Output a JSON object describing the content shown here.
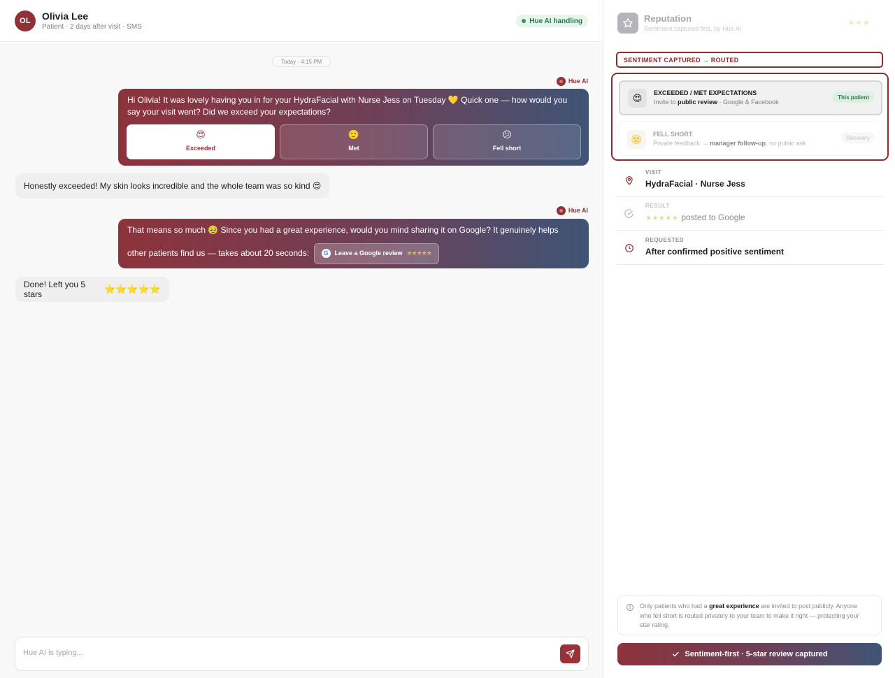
{
  "chat": {
    "header": {
      "avatar_initials": "OL",
      "name": "Olivia Lee",
      "meta": "Patient · 2 days after visit · SMS",
      "status": "Hue AI handling"
    },
    "date_chip": "Today · 4:15 PM",
    "ai_sender": "Hue AI",
    "messages": [
      {
        "sender": "Hue AI",
        "text": "Hi Olivia! It was lovely having you in for your HydraFacial with Nurse Jess on Tuesday 💛 Quick one — how would you say your visit went? Did we exceed your expectations?",
        "choices": [
          {
            "emoji": "😍",
            "label": "Exceeded",
            "selected": true
          },
          {
            "emoji": "🙂",
            "label": "Met",
            "selected": false
          },
          {
            "emoji": "😕",
            "label": "Fell short",
            "selected": false
          }
        ]
      },
      {
        "sender": "patient",
        "text": "Honestly exceeded! My skin looks incredible and the whole team was so kind 😍"
      },
      {
        "sender": "Hue AI",
        "text": "That means so much 🥹 Since you had a great experience, would you mind sharing it on Google? It genuinely helps other patients find us — takes about 20 seconds:",
        "button_label": "Leave a Google review",
        "button_stars": "★★★★★"
      },
      {
        "sender": "patient",
        "text": "Done! Left you 5 stars",
        "stars": "⭐⭐⭐⭐⭐"
      }
    ],
    "composer_placeholder": "Hue AI is typing..."
  },
  "panel": {
    "title": "Reputation",
    "subtitle": "Sentiment captured first, by Hue AI",
    "rating_display": "★★★",
    "routing_label": "SENTIMENT CAPTURED → ROUTED",
    "routes": [
      {
        "icon": "😍",
        "title": "EXCEEDED / MET EXPECTATIONS",
        "desc_prefix": "Invite to ",
        "desc_bold": "public review",
        "desc_suffix": " · Google & Facebook",
        "tag": "This patient",
        "active": true
      },
      {
        "icon": "🙁",
        "title": "FELL SHORT",
        "desc_prefix": "Private feedback → ",
        "desc_bold": "manager follow-up",
        "desc_suffix": ", no public ask",
        "tag": "Recovery",
        "active": false
      }
    ],
    "info": [
      {
        "icon": "pin-icon",
        "label": "VISIT",
        "value": "HydraFacial · Nurse Jess"
      },
      {
        "icon": "check-circle-icon",
        "label": "RESULT",
        "stars": "★★★★★",
        "value": "posted to Google"
      },
      {
        "icon": "clock-icon",
        "label": "REQUESTED",
        "value": "After confirmed positive sentiment"
      }
    ],
    "note": {
      "pre": "Only patients who had a ",
      "bold": "great experience",
      "post": " are invited to post publicly. Anyone who fell short is routed privately to your team to make it right — protecting your star rating."
    },
    "cta_label": "Sentiment-first · 5-star review captured"
  },
  "colors": {
    "brand": "#8f3238",
    "gradient_start": "#8d333c",
    "gradient_end": "#3f5476",
    "success": "#2f9a5c"
  }
}
